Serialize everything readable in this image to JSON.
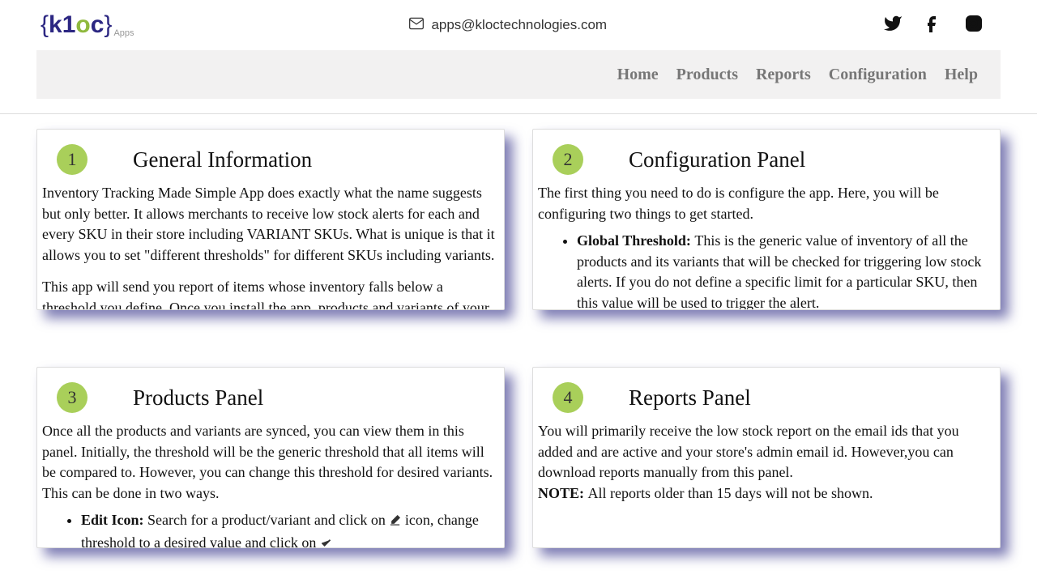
{
  "header": {
    "email": "apps@kloctechnologies.com"
  },
  "nav": {
    "home": "Home",
    "products": "Products",
    "reports": "Reports",
    "config": "Configuration",
    "help": "Help"
  },
  "cards": {
    "c1": {
      "num": "1",
      "title": "General Information",
      "p1": "Inventory Tracking Made Simple App does exactly what the name suggests but only better. It allows merchants to receive low stock alerts for each and every SKU in their store including VARIANT SKUs. What is unique is that it allows you to set \"different thresholds\" for different SKUs including variants.",
      "p2": "This app will send you report of items whose inventory falls below a threshold you define. Once you install the app, products and variants of your store get"
    },
    "c2": {
      "num": "2",
      "title": "Configuration Panel",
      "p1": "The first thing you need to do is configure the app. Here, you will be configuring two things to get started.",
      "b1label": "Global Threshold: ",
      "b1text": "This is the generic value of inventory of all the products and its variants that will be checked for triggering low stock alerts. If you do not define a specific limit for a particular SKU, then this value will be used to trigger the alert."
    },
    "c3": {
      "num": "3",
      "title": "Products Panel",
      "p1": "Once all the products and variants are synced, you can view them in this panel. Initially, the threshold will be the generic threshold that all items will be compared to. However, you can change this threshold for desired variants. This can be done in two ways.",
      "b1label": "Edit Icon: ",
      "b1a": "Search for a product/variant and click on ",
      "b1b": " icon, change threshold to a desired value and click on "
    },
    "c4": {
      "num": "4",
      "title": "Reports Panel",
      "p1": "You will primarily receive the low stock report on the email ids that you added and are active and your store's admin email id. However,you can download reports manually from this panel.",
      "notelabel": "NOTE: ",
      "notetext": "All reports older than 15 days will not be shown."
    }
  }
}
